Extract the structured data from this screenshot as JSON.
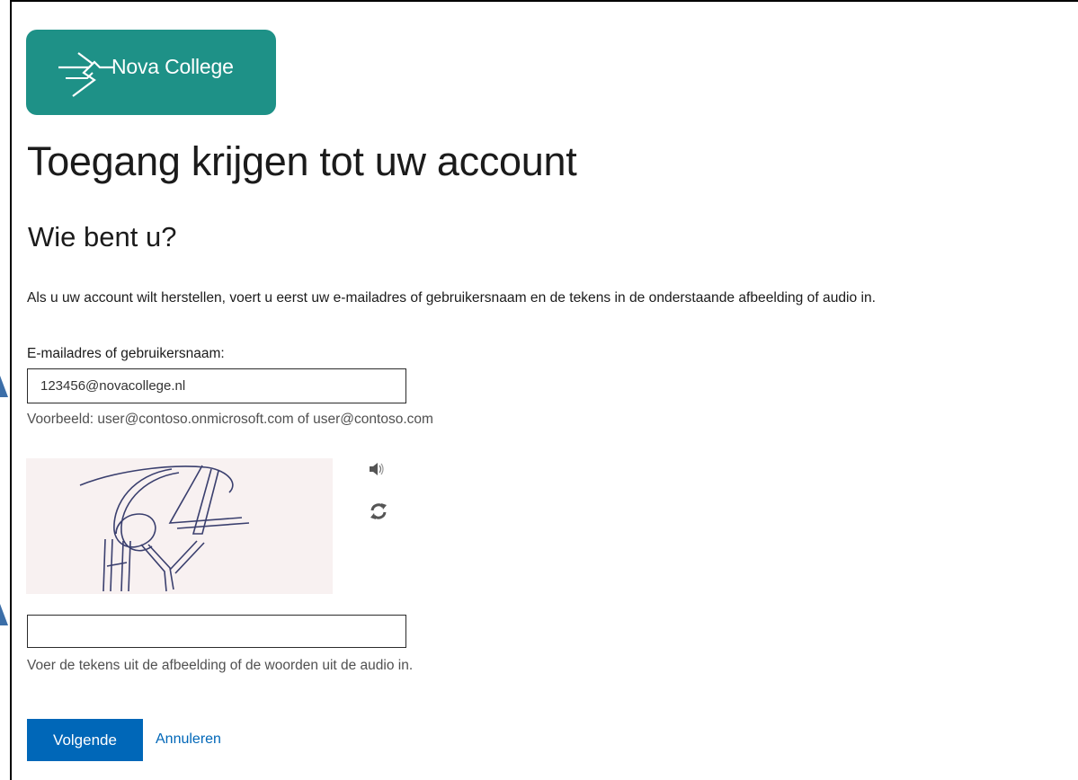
{
  "brand": {
    "name": "Nova College",
    "color": "#1e9187"
  },
  "page": {
    "title": "Toegang krijgen tot uw account",
    "subtitle": "Wie bent u?",
    "intro": "Als u uw account wilt herstellen, voert u eerst uw e-mailadres of gebruikersnaam en de tekens in de onderstaande afbeelding of audio in."
  },
  "email_field": {
    "label": "E-mailadres of gebruikersnaam:",
    "value": "123456@novacollege.nl",
    "example": "Voorbeeld: user@contoso.onmicrosoft.com of user@contoso.com"
  },
  "captcha": {
    "image_text": "64 HY",
    "audio_icon": "speaker-icon",
    "refresh_icon": "refresh-icon",
    "input_value": "",
    "hint": "Voer de tekens uit de afbeelding of de woorden uit de audio in."
  },
  "actions": {
    "next_label": "Volgende",
    "cancel_label": "Annuleren",
    "primary_color": "#0067b8"
  }
}
